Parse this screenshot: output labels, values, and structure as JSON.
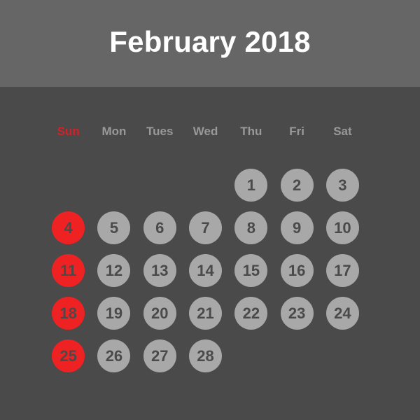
{
  "header": {
    "title": "February 2018",
    "background_color": "#666666",
    "text_color": "#ffffff"
  },
  "theme": {
    "page_background": "#4a4a4a",
    "accent_red": "#ee2222",
    "weekday_red": "#d42028",
    "day_circle_gray": "#a8a8a8",
    "weekday_label_gray": "#999999",
    "day_number_color": "#4a4a4a"
  },
  "weekdays": [
    {
      "label": "Sun",
      "highlight": true
    },
    {
      "label": "Mon",
      "highlight": false
    },
    {
      "label": "Tues",
      "highlight": false
    },
    {
      "label": "Wed",
      "highlight": false
    },
    {
      "label": "Thu",
      "highlight": false
    },
    {
      "label": "Fri",
      "highlight": false
    },
    {
      "label": "Sat",
      "highlight": false
    }
  ],
  "weeks": [
    [
      {
        "day": "",
        "empty": true,
        "sunday": false
      },
      {
        "day": "",
        "empty": true,
        "sunday": false
      },
      {
        "day": "",
        "empty": true,
        "sunday": false
      },
      {
        "day": "",
        "empty": true,
        "sunday": false
      },
      {
        "day": "1",
        "empty": false,
        "sunday": false
      },
      {
        "day": "2",
        "empty": false,
        "sunday": false
      },
      {
        "day": "3",
        "empty": false,
        "sunday": false
      }
    ],
    [
      {
        "day": "4",
        "empty": false,
        "sunday": true
      },
      {
        "day": "5",
        "empty": false,
        "sunday": false
      },
      {
        "day": "6",
        "empty": false,
        "sunday": false
      },
      {
        "day": "7",
        "empty": false,
        "sunday": false
      },
      {
        "day": "8",
        "empty": false,
        "sunday": false
      },
      {
        "day": "9",
        "empty": false,
        "sunday": false
      },
      {
        "day": "10",
        "empty": false,
        "sunday": false
      }
    ],
    [
      {
        "day": "11",
        "empty": false,
        "sunday": true
      },
      {
        "day": "12",
        "empty": false,
        "sunday": false
      },
      {
        "day": "13",
        "empty": false,
        "sunday": false
      },
      {
        "day": "14",
        "empty": false,
        "sunday": false
      },
      {
        "day": "15",
        "empty": false,
        "sunday": false
      },
      {
        "day": "16",
        "empty": false,
        "sunday": false
      },
      {
        "day": "17",
        "empty": false,
        "sunday": false
      }
    ],
    [
      {
        "day": "18",
        "empty": false,
        "sunday": true
      },
      {
        "day": "19",
        "empty": false,
        "sunday": false
      },
      {
        "day": "20",
        "empty": false,
        "sunday": false
      },
      {
        "day": "21",
        "empty": false,
        "sunday": false
      },
      {
        "day": "22",
        "empty": false,
        "sunday": false
      },
      {
        "day": "23",
        "empty": false,
        "sunday": false
      },
      {
        "day": "24",
        "empty": false,
        "sunday": false
      }
    ],
    [
      {
        "day": "25",
        "empty": false,
        "sunday": true
      },
      {
        "day": "26",
        "empty": false,
        "sunday": false
      },
      {
        "day": "27",
        "empty": false,
        "sunday": false
      },
      {
        "day": "28",
        "empty": false,
        "sunday": false
      },
      {
        "day": "",
        "empty": true,
        "sunday": false
      },
      {
        "day": "",
        "empty": true,
        "sunday": false
      },
      {
        "day": "",
        "empty": true,
        "sunday": false
      }
    ]
  ]
}
